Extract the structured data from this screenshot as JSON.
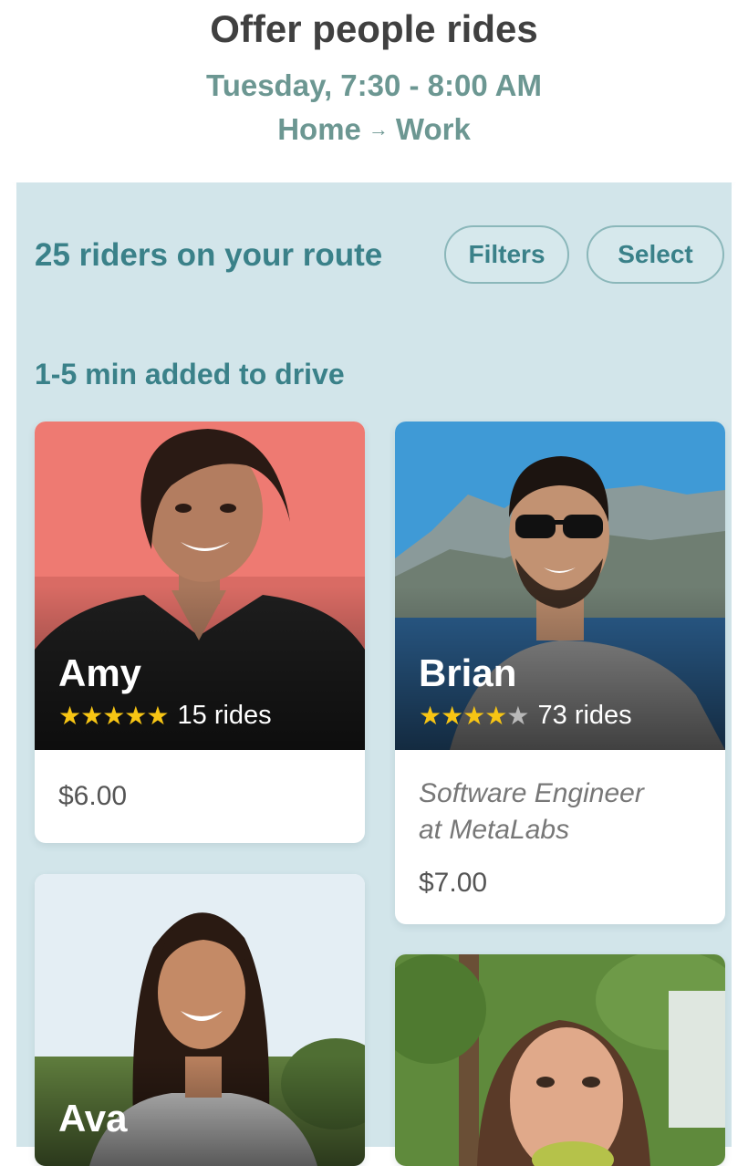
{
  "header": {
    "title": "Offer people rides",
    "time": "Tuesday, 7:30 - 8:00 AM",
    "route_from": "Home",
    "route_arrow": "→",
    "route_to": "Work"
  },
  "toolbar": {
    "riders_count": "25 riders on your route",
    "filters_label": "Filters",
    "select_label": "Select"
  },
  "section": {
    "label": "1-5 min added to drive"
  },
  "riders": [
    {
      "name": "Amy",
      "stars": "★★★★★",
      "stars_off": "",
      "rating": 5,
      "rides": "15 rides",
      "price": "$6.00"
    },
    {
      "name": "Brian",
      "stars": "★★★★",
      "stars_off": "★",
      "rating": 4,
      "rides": "73 rides",
      "job_line1": "Software Engineer",
      "job_line2": "at MetaLabs",
      "price": "$7.00"
    },
    {
      "name": "Ava"
    }
  ],
  "colors": {
    "accent": "#3a8189",
    "subtitle": "#6c9792",
    "panel_bg": "#d2e5ea",
    "star": "#f7c514"
  }
}
